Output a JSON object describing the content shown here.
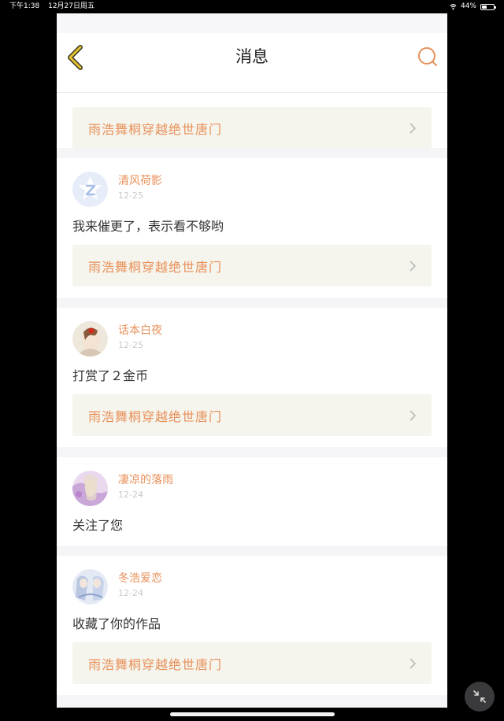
{
  "status_bar": {
    "time": "下午1:38",
    "date": "12月27日周五",
    "battery": "44%",
    "battery_level": 0.44
  },
  "navbar": {
    "title": "消息",
    "back_icon": "chevron-left-icon",
    "search_icon": "search-icon"
  },
  "colors": {
    "accent": "#e8905a",
    "book_bg": "#f5f5ed",
    "back_yellow": "#e8c330"
  },
  "partial_card": {
    "book": "雨浩舞桐穿越绝世唐门"
  },
  "messages": [
    {
      "user": "清风荷影",
      "date": "12-25",
      "text": "我来催更了，表示看不够哟",
      "book": "雨浩舞桐穿越绝世唐门"
    },
    {
      "user": "话本白夜",
      "date": "12-25",
      "text": "打赏了２金币",
      "book": "雨浩舞桐穿越绝世唐门"
    },
    {
      "user": "凄凉的落雨",
      "date": "12-24",
      "text": "关注了您"
    },
    {
      "user": "冬浩爱恋",
      "date": "12-24",
      "text": "收藏了你的作品",
      "book": "雨浩舞桐穿越绝世唐门"
    }
  ]
}
